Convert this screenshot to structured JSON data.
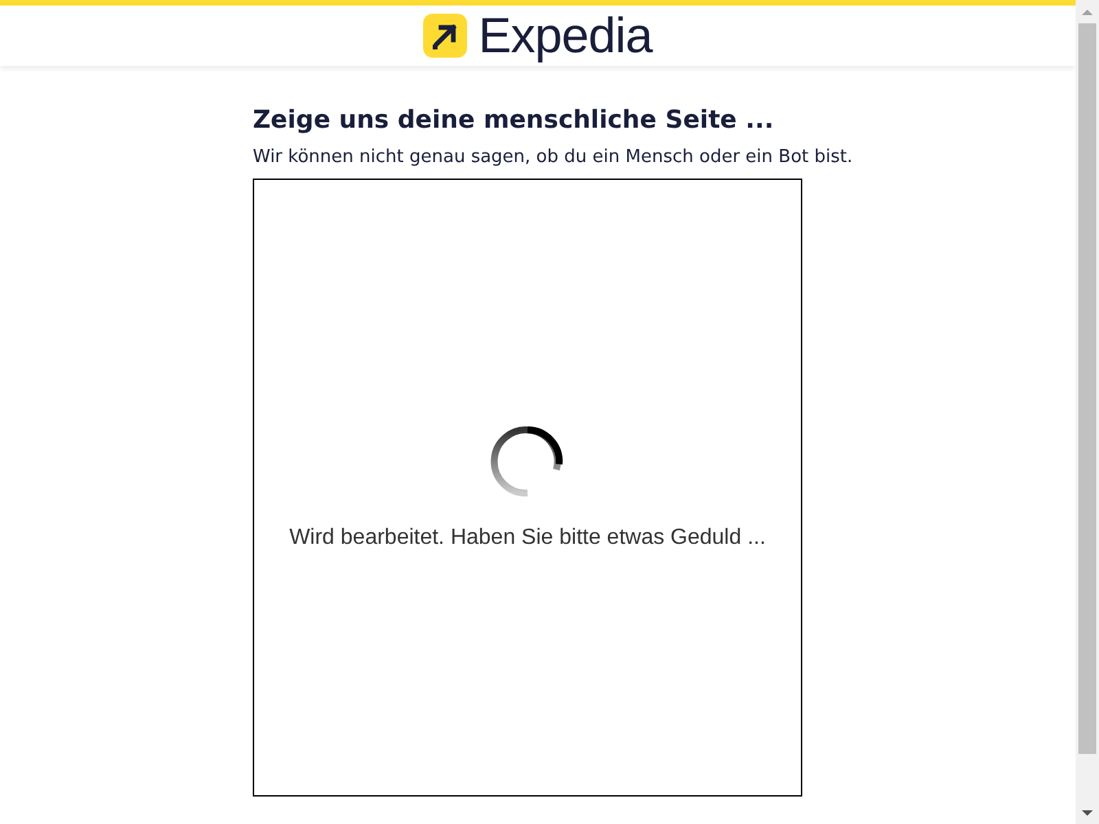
{
  "header": {
    "logo": "Expedia"
  },
  "heading": "Zeige uns deine menschliche Seite ...",
  "subtext": "Wir können nicht genau sagen, ob du ein Mensch oder ein Bot bist.",
  "challenge": {
    "status": "Wird bearbeitet. Haben Sie bitte etwas Geduld ..."
  }
}
